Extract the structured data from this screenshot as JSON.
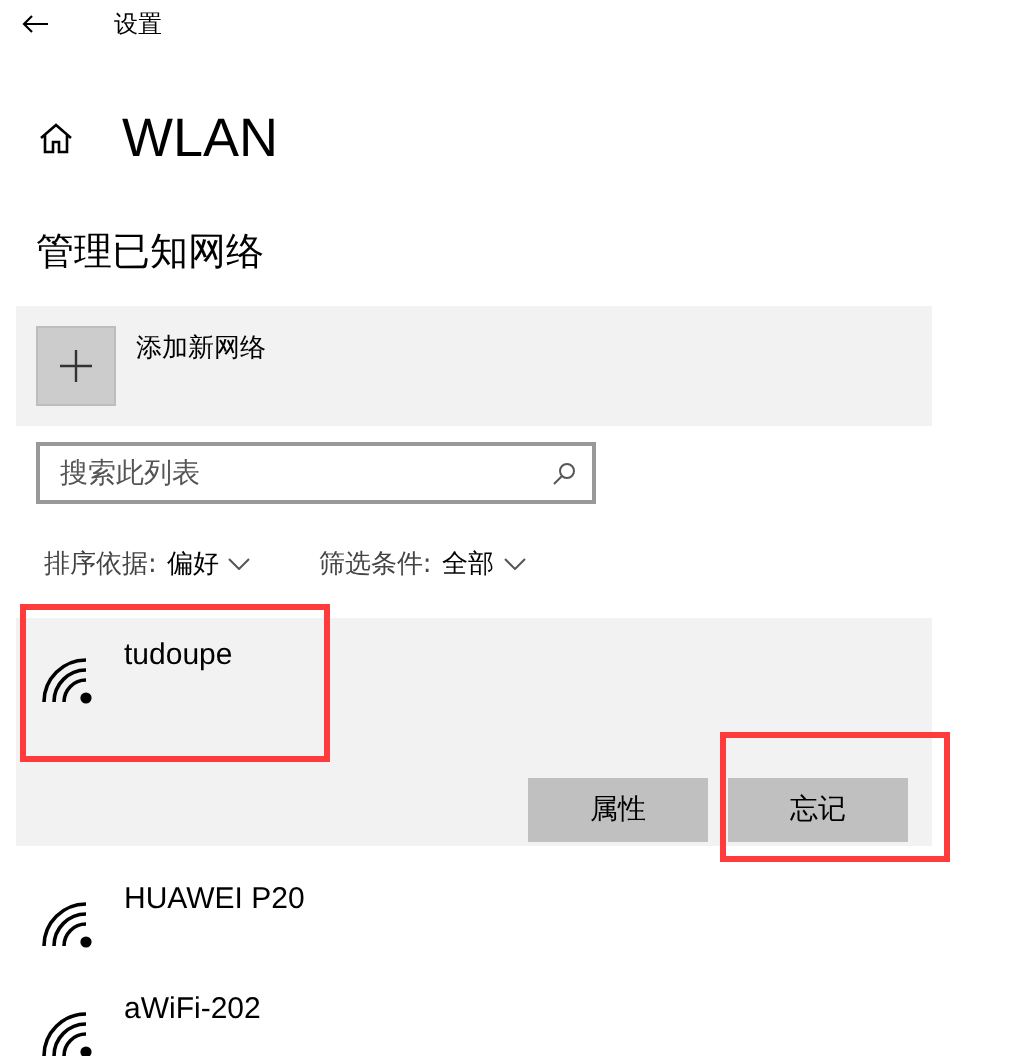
{
  "window": {
    "title": "设置"
  },
  "page_title": "WLAN",
  "section_title": "管理已知网络",
  "add_network": {
    "label": "添加新网络"
  },
  "search": {
    "placeholder": "搜索此列表"
  },
  "sort": {
    "label": "排序依据:",
    "value": "偏好"
  },
  "filter": {
    "label": "筛选条件:",
    "value": "全部"
  },
  "networks": [
    {
      "name": "tudoupe",
      "selected": true,
      "annotated": true,
      "buttons": [
        {
          "label": "属性",
          "annotated": false
        },
        {
          "label": "忘记",
          "annotated": true
        }
      ]
    },
    {
      "name": "HUAWEI P20",
      "selected": false,
      "annotated": false
    },
    {
      "name": "aWiFi-202",
      "selected": false,
      "annotated": false
    }
  ]
}
